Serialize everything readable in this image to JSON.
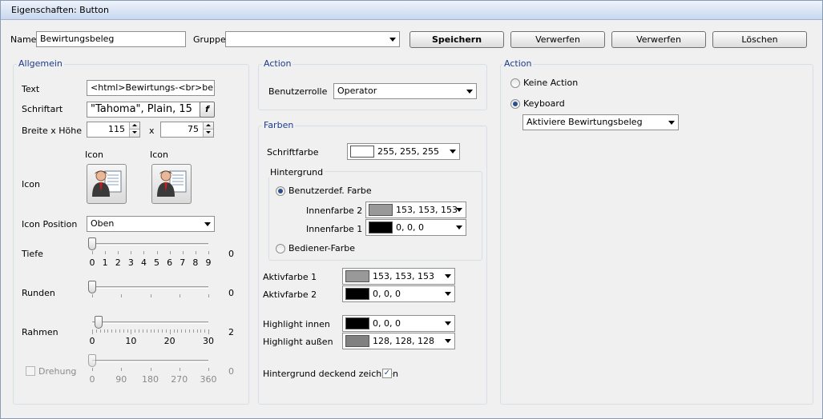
{
  "window": {
    "title": "Eigenschaften: Button"
  },
  "header": {
    "name_label": "Name",
    "name_value": "Bewirtungsbeleg",
    "gruppe_label": "Gruppe",
    "gruppe_value": "",
    "buttons": {
      "save": "Speichern",
      "discard1": "Verwerfen",
      "discard2": "Verwerfen",
      "delete": "Löschen"
    }
  },
  "allgemein": {
    "title": "Allgemein",
    "text_label": "Text",
    "text_value": "<html>Bewirtungs-<br>beleg<,",
    "schriftart_label": "Schriftart",
    "schriftart_value": "\"Tahoma\", Plain, 15",
    "font_button_glyph": "f",
    "size_label": "Breite x Höhe",
    "width_value": "115",
    "x_label": "x",
    "height_value": "75",
    "icon_label": "Icon",
    "icon1_caption": "Icon",
    "icon2_caption": "Icon",
    "icon_position_label": "Icon Position",
    "icon_position_value": "Oben",
    "tiefe": {
      "label": "Tiefe",
      "value": "0",
      "value_num": 0,
      "min": 0,
      "max": 9,
      "ticks": [
        "0",
        "1",
        "2",
        "3",
        "4",
        "5",
        "6",
        "7",
        "8",
        "9"
      ]
    },
    "runden": {
      "label": "Runden",
      "value": "0",
      "value_num": 0,
      "min": 0,
      "max": 10
    },
    "rahmen": {
      "label": "Rahmen",
      "value": "2",
      "value_num": 2,
      "min": 0,
      "max": 36,
      "ticks": [
        "0",
        "10",
        "20",
        "30"
      ]
    },
    "drehung": {
      "label": "Drehung",
      "value": "0",
      "value_num": 0,
      "min": 0,
      "max": 360,
      "ticks": [
        "0",
        "90",
        "180",
        "270",
        "360"
      ]
    }
  },
  "action_mid": {
    "title": "Action",
    "benutzerrolle_label": "Benutzerrolle",
    "benutzerrolle_value": "Operator"
  },
  "farben": {
    "title": "Farben",
    "schriftfarbe_label": "Schriftfarbe",
    "schriftfarbe_value": "255, 255, 255",
    "schriftfarbe_color": "#ffffff",
    "hintergrund_title": "Hintergrund",
    "benutzerdef_label": "Benutzerdef. Farbe",
    "innenfarbe2_label": "Innenfarbe 2",
    "innenfarbe2_value": "153, 153, 153",
    "innenfarbe2_color": "#999999",
    "innenfarbe1_label": "Innenfarbe 1",
    "innenfarbe1_value": "0, 0, 0",
    "innenfarbe1_color": "#000000",
    "bediener_label": "Bediener-Farbe",
    "aktivfarbe1_label": "Aktivfarbe 1",
    "aktivfarbe1_value": "153, 153, 153",
    "aktivfarbe1_color": "#999999",
    "aktivfarbe2_label": "Aktivfarbe 2",
    "aktivfarbe2_value": "0, 0, 0",
    "aktivfarbe2_color": "#000000",
    "highlight_innen_label": "Highlight innen",
    "highlight_innen_value": "0, 0, 0",
    "highlight_innen_color": "#000000",
    "highlight_aussen_label": "Highlight außen",
    "highlight_aussen_value": "128, 128, 128",
    "highlight_aussen_color": "#808080",
    "deckend_label": "Hintergrund deckend zeichnen"
  },
  "action_right": {
    "title": "Action",
    "keine_action_label": "Keine Action",
    "keyboard_label": "Keyboard",
    "keyboard_value": "Aktiviere Bewirtungsbeleg"
  }
}
